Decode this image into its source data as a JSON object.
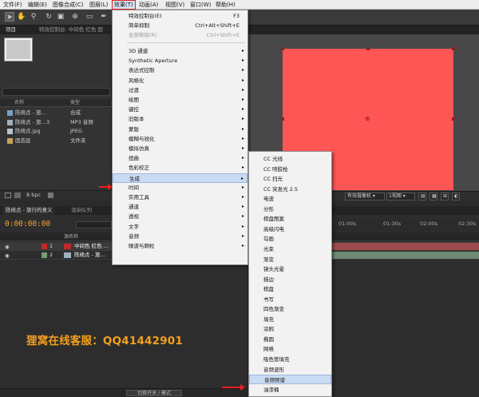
{
  "menubar": {
    "items": [
      "文件(F)",
      "编辑(E)",
      "图像合成(C)",
      "图层(L)",
      "效果(T)",
      "动画(A)",
      "视图(V)",
      "窗口(W)",
      "帮助(H)"
    ]
  },
  "project": {
    "tabs": [
      "项目",
      "特效控制台: 中间色 红色 固"
    ],
    "columns": [
      "名称",
      "类型"
    ],
    "items": [
      {
        "name": "陈绮贞 - 旅…",
        "type": "合成"
      },
      {
        "name": "陈绮贞 - 旅…3",
        "type": "MP3 音频"
      },
      {
        "name": "陈绮贞.jpg",
        "type": "JPEG"
      },
      {
        "name": "固态层",
        "type": "文件夹"
      }
    ],
    "bpc": "8 bpc"
  },
  "viewer": {
    "view_mode": "有效摄像机",
    "view_count": "1视图"
  },
  "timeline": {
    "tabs": [
      "陈绮贞 - 旅行的意义",
      "渲染队列"
    ],
    "timecode": "0:00:00:00",
    "ruler": [
      "01:00s",
      "01:30s",
      "02:00s",
      "02:30s"
    ],
    "header_name": "源名称",
    "layers": [
      {
        "num": "1",
        "name": "中间色 红色 …",
        "color": "#c02a2a"
      },
      {
        "num": "2",
        "name": "陈绮贞 - 旅…",
        "color": "#7a9a7a"
      }
    ],
    "footer": "切换开关 / 模式"
  },
  "effects_menu": {
    "top": [
      {
        "label": "特效控制台(E)",
        "shortcut": "F3"
      },
      {
        "label": "简单抑制",
        "shortcut": "Ctrl+Alt+Shift+E"
      },
      {
        "label": "全部移除(R)",
        "shortcut": "Ctrl+Shift+E",
        "disabled": true
      }
    ],
    "categories": [
      "3D 通道",
      "Synthetic Aperture",
      "表达式控制",
      "风格化",
      "过渡",
      "绘图",
      "键控",
      "旧版本",
      "蒙版",
      "模糊与锐化",
      "模拟仿真",
      "扭曲",
      "色彩校正",
      "生成",
      "时间",
      "实用工具",
      "通道",
      "透视",
      "文字",
      "音频",
      "噪波与颗粒"
    ],
    "highlighted": "生成"
  },
  "generate_menu": {
    "items": [
      "CC 光线",
      "CC 喷胶枪",
      "CC 扫光",
      "CC 突发光 2.5",
      "电波",
      "分形",
      "棋盘图案",
      "高级闪电",
      "勾画",
      "光束",
      "渐变",
      "镜头光晕",
      "描边",
      "棋盘",
      "书写",
      "四色渐变",
      "填充",
      "涂鸦",
      "椭圆",
      "网格",
      "吸色管填充",
      "音频波形",
      "音频频谱",
      "油漆桶"
    ],
    "highlighted": "音频频谱"
  },
  "watermark": "狸窝在线客服：QQ41442901",
  "colors": {
    "solid_red": "#fe5555",
    "timecode": "#f0a834",
    "menu_highlight": "#c9dbf3",
    "watermark": "#f5a01e"
  }
}
